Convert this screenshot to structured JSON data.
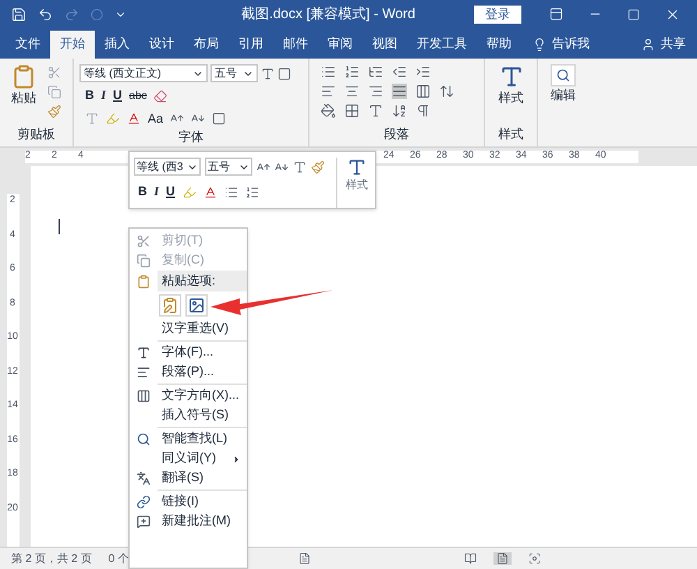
{
  "title_bar": {
    "title": "截图.docx [兼容模式] - Word",
    "login_button": "登录"
  },
  "tabs": [
    {
      "label": "文件",
      "selected": false
    },
    {
      "label": "开始",
      "selected": true
    },
    {
      "label": "插入",
      "selected": false
    },
    {
      "label": "设计",
      "selected": false
    },
    {
      "label": "布局",
      "selected": false
    },
    {
      "label": "引用",
      "selected": false
    },
    {
      "label": "邮件",
      "selected": false
    },
    {
      "label": "审阅",
      "selected": false
    },
    {
      "label": "视图",
      "selected": false
    },
    {
      "label": "开发工具",
      "selected": false
    },
    {
      "label": "帮助",
      "selected": false
    }
  ],
  "tell_me": "告诉我",
  "share": "共享",
  "ribbon": {
    "clipboard": {
      "paste": "粘贴",
      "label": "剪贴板"
    },
    "font": {
      "font_name": "等线 (西文正文)",
      "font_size": "五号",
      "bold": "B",
      "italic": "I",
      "underline": "U",
      "strikethrough": "abc",
      "change_case": "Aa",
      "label": "字体"
    },
    "paragraph": {
      "label": "段落"
    },
    "styles": {
      "button": "样式",
      "label": "样式"
    },
    "editing": {
      "button": "编辑"
    }
  },
  "ruler": {
    "labels": [
      "2",
      "2",
      "4",
      "24",
      "26",
      "28",
      "30",
      "32",
      "34",
      "36",
      "38",
      "40"
    ]
  },
  "vertical_ruler": {
    "labels": [
      "2",
      "4",
      "6",
      "8",
      "10",
      "12",
      "14",
      "16",
      "18",
      "20"
    ]
  },
  "mini_toolbar": {
    "font_name": "等线 (西3",
    "font_size": "五号",
    "bold": "B",
    "italic": "I",
    "underline": "U",
    "styles": "样式"
  },
  "context_menu": [
    {
      "kind": "item",
      "label": "剪切(T)",
      "disabled": true
    },
    {
      "kind": "item",
      "label": "复制(C)",
      "disabled": true
    },
    {
      "kind": "header",
      "label": "粘贴选项:"
    },
    {
      "kind": "paste_options"
    },
    {
      "kind": "item",
      "label": "汉字重选(V)",
      "disabled": false
    },
    {
      "kind": "separator"
    },
    {
      "kind": "item",
      "label": "字体(F)...",
      "disabled": false
    },
    {
      "kind": "item",
      "label": "段落(P)...",
      "disabled": false
    },
    {
      "kind": "separator"
    },
    {
      "kind": "item",
      "label": "文字方向(X)...",
      "disabled": false
    },
    {
      "kind": "item",
      "label": "插入符号(S)",
      "disabled": false
    },
    {
      "kind": "separator"
    },
    {
      "kind": "item",
      "label": "智能查找(L)",
      "disabled": false
    },
    {
      "kind": "submenu",
      "label": "同义词(Y)",
      "disabled": false
    },
    {
      "kind": "item",
      "label": "翻译(S)",
      "disabled": false
    },
    {
      "kind": "separator"
    },
    {
      "kind": "item",
      "label": "链接(I)",
      "disabled": false
    },
    {
      "kind": "item",
      "label": "新建批注(M)",
      "disabled": false
    }
  ],
  "status_bar": {
    "page": "第 2 页，共 2 页",
    "words": "0 个"
  }
}
